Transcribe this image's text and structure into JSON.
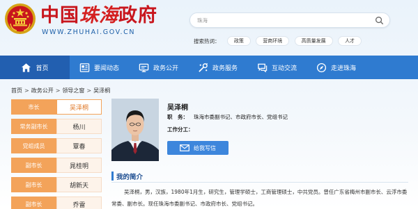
{
  "header": {
    "logo_part_a": "中国",
    "logo_part_b": "珠海",
    "logo_part_c": "政府",
    "logo_url": "WWW.ZHUHAI.GOV.CN",
    "search_value": "珠海",
    "hot_label": "搜索热词：",
    "hot_words": [
      "政策",
      "营商环境",
      "高质量发展",
      "人才"
    ]
  },
  "nav": {
    "items": [
      {
        "label": "首页",
        "icon": "home-icon"
      },
      {
        "label": "要闻动态",
        "icon": "news-icon"
      },
      {
        "label": "政务公开",
        "icon": "gov-open-icon"
      },
      {
        "label": "政务服务",
        "icon": "gov-service-icon"
      },
      {
        "label": "互动交流",
        "icon": "chat-icon"
      },
      {
        "label": "走进珠海",
        "icon": "explore-icon"
      }
    ],
    "active_index": 0
  },
  "breadcrumb": [
    "首页",
    "政务公开",
    "领导之窗",
    "吴泽桐"
  ],
  "sidebar": {
    "rows": [
      {
        "title": "市长",
        "name": "吴泽桐"
      },
      {
        "title": "常务副市长",
        "name": "杨川"
      },
      {
        "title": "党组成员",
        "name": "覃春"
      },
      {
        "title": "副市长",
        "name": "晁桂明"
      },
      {
        "title": "副市长",
        "name": "胡新天"
      },
      {
        "title": "副市长",
        "name": "乔雷"
      }
    ],
    "active_index": 0
  },
  "profile": {
    "name": "吴泽桐",
    "duty_label": "职　务：",
    "duty_value": "珠海市委副书记、市政府市长、党组书记",
    "work_label": "工作分工：",
    "letter_button": "给我写信"
  },
  "intro": {
    "title": "我的简介",
    "text": "吴泽桐，男，汉族，1980年1月生，研究生，管理学硕士，工商管理硕士，中共党员。曾任广东省梅州市副市长、云浮市委常委、副市长。现任珠海市委副书记、市政府市长、党组书记。"
  },
  "colors": {
    "nav_blue": "#2f7bd0",
    "nav_active": "#225fb0",
    "accent_orange": "#f3a35a",
    "logo_red": "#c8161d"
  }
}
